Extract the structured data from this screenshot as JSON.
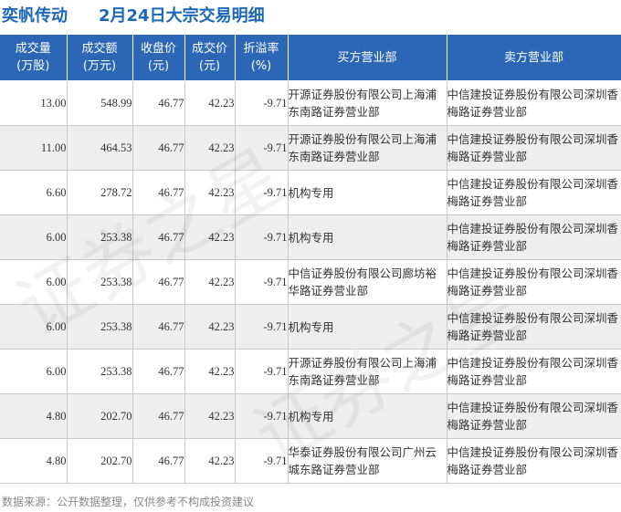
{
  "title": {
    "stock_name": "奕帆传动",
    "subtitle": "2月24日大宗交易明细"
  },
  "watermark_text": "证券之星",
  "colors": {
    "header_bg": "#2b67b5",
    "title": "#1a66b8",
    "negative_pct": "#2e9a2e",
    "row_alt": "#eeeeee"
  },
  "chart_data": {
    "type": "table",
    "columns": [
      {
        "label": "成交量",
        "unit": "(万股)"
      },
      {
        "label": "成交额",
        "unit": "(万元)"
      },
      {
        "label": "收盘价",
        "unit": "(元)"
      },
      {
        "label": "成交价",
        "unit": "(元)"
      },
      {
        "label": "折溢率",
        "unit": "(%)"
      },
      {
        "label": "买方营业部",
        "unit": ""
      },
      {
        "label": "卖方营业部",
        "unit": ""
      }
    ],
    "rows": [
      {
        "volume": "13.00",
        "amount": "548.99",
        "close": "46.77",
        "price": "42.23",
        "premium": "-9.71",
        "buyer": "开源证券股份有限公司上海浦东南路证券营业部",
        "seller": "中信建投证券股份有限公司深圳香梅路证券营业部"
      },
      {
        "volume": "11.00",
        "amount": "464.53",
        "close": "46.77",
        "price": "42.23",
        "premium": "-9.71",
        "buyer": "开源证券股份有限公司上海浦东南路证券营业部",
        "seller": "中信建投证券股份有限公司深圳香梅路证券营业部"
      },
      {
        "volume": "6.60",
        "amount": "278.72",
        "close": "46.77",
        "price": "42.23",
        "premium": "-9.71",
        "buyer": "机构专用",
        "seller": "中信建投证券股份有限公司深圳香梅路证券营业部"
      },
      {
        "volume": "6.00",
        "amount": "253.38",
        "close": "46.77",
        "price": "42.23",
        "premium": "-9.71",
        "buyer": "机构专用",
        "seller": "中信建投证券股份有限公司深圳香梅路证券营业部"
      },
      {
        "volume": "6.00",
        "amount": "253.38",
        "close": "46.77",
        "price": "42.23",
        "premium": "-9.71",
        "buyer": "中信证券股份有限公司廊坊裕华路证券营业部",
        "seller": "中信建投证券股份有限公司深圳香梅路证券营业部"
      },
      {
        "volume": "6.00",
        "amount": "253.38",
        "close": "46.77",
        "price": "42.23",
        "premium": "-9.71",
        "buyer": "机构专用",
        "seller": "中信建投证券股份有限公司深圳香梅路证券营业部"
      },
      {
        "volume": "6.00",
        "amount": "253.38",
        "close": "46.77",
        "price": "42.23",
        "premium": "-9.71",
        "buyer": "开源证券股份有限公司上海浦东南路证券营业部",
        "seller": "中信建投证券股份有限公司深圳香梅路证券营业部"
      },
      {
        "volume": "4.80",
        "amount": "202.70",
        "close": "46.77",
        "price": "42.23",
        "premium": "-9.71",
        "buyer": "机构专用",
        "seller": "中信建投证券股份有限公司深圳香梅路证券营业部"
      },
      {
        "volume": "4.80",
        "amount": "202.70",
        "close": "46.77",
        "price": "42.23",
        "premium": "-9.71",
        "buyer": "华泰证券股份有限公司广州云城东路证券营业部",
        "seller": "中信建投证券股份有限公司深圳香梅路证券营业部"
      }
    ]
  },
  "footer": "数据来源：公开数据整理，仅供参考不构成投资建议"
}
